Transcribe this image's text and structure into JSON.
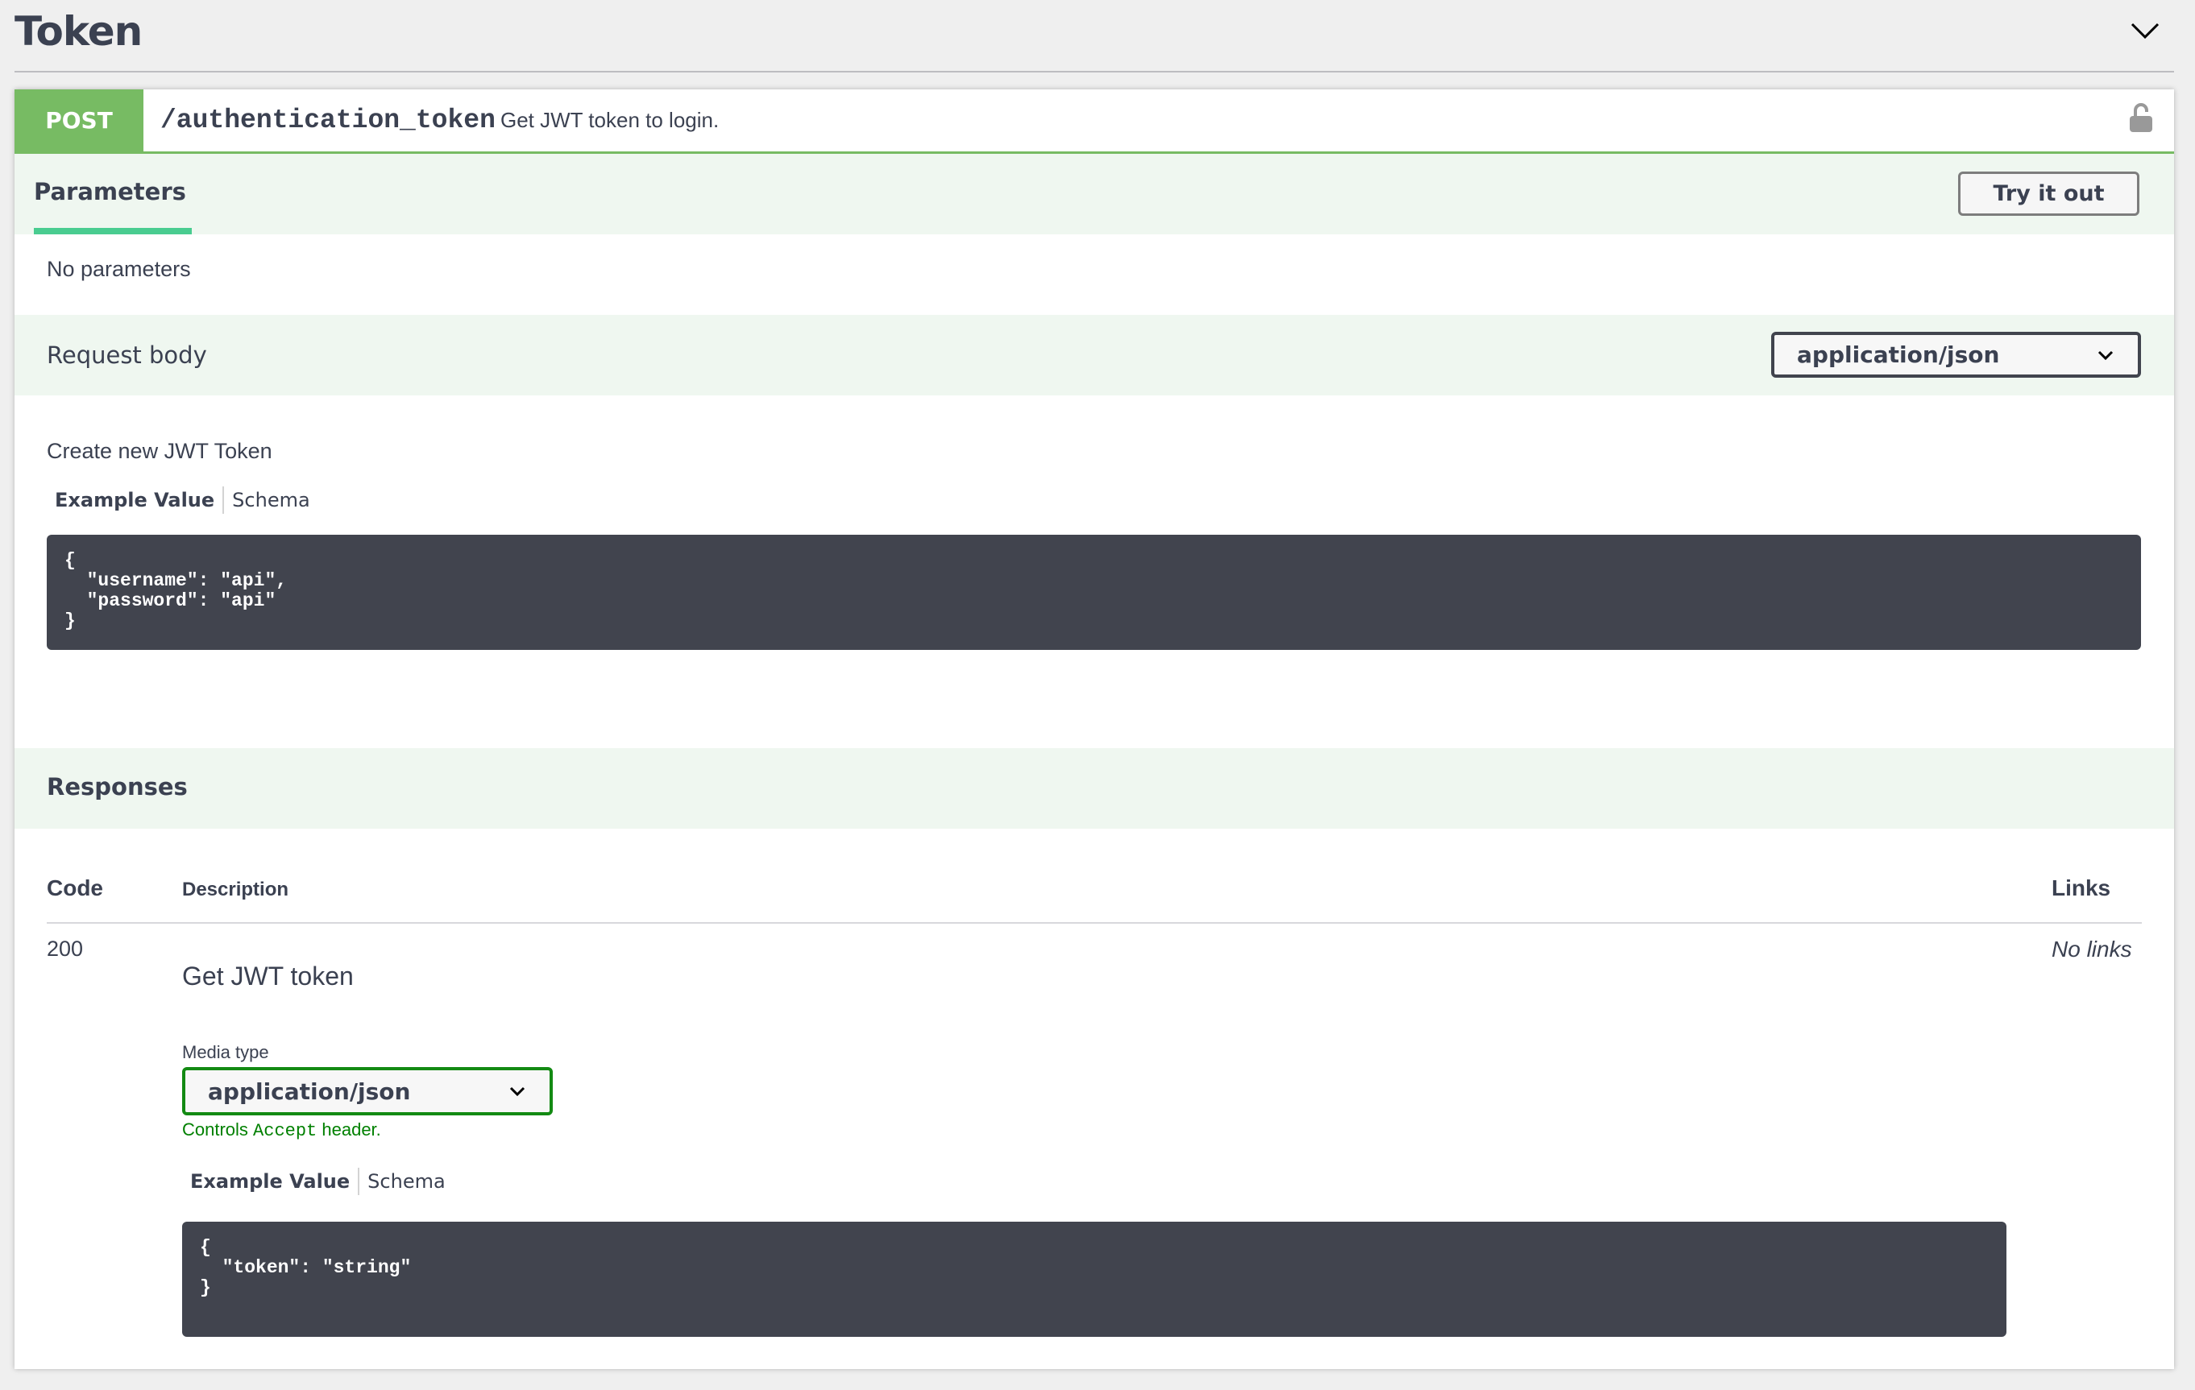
{
  "tag": {
    "title": "Token",
    "collapse_icon": "chevron-down-icon"
  },
  "operation": {
    "method": "POST",
    "method_color": "#77bb63",
    "path": "/authentication_token",
    "summary": "Get JWT token to login.",
    "lock_icon": "unlocked-padlock-icon"
  },
  "parameters": {
    "tab_label": "Parameters",
    "try_it_out_label": "Try it out",
    "empty_text": "No parameters"
  },
  "request_body": {
    "label": "Request body",
    "content_type": "application/json",
    "description": "Create new JWT Token",
    "tabs": {
      "example": "Example Value",
      "schema": "Schema"
    },
    "example": "{\n  \"username\": \"api\",\n  \"password\": \"api\"\n}"
  },
  "responses": {
    "title": "Responses",
    "columns": {
      "code": "Code",
      "description": "Description",
      "links": "Links"
    },
    "rows": [
      {
        "code": "200",
        "description": "Get JWT token",
        "links": "No links",
        "media_type_label": "Media type",
        "media_type": "application/json",
        "controls_prefix": "Controls ",
        "controls_code": "Accept",
        "controls_suffix": " header.",
        "tabs": {
          "example": "Example Value",
          "schema": "Schema"
        },
        "example": "{\n  \"token\": \"string\"\n}"
      }
    ]
  },
  "colors": {
    "accent_green": "#49cc90",
    "band_background": "#eff7f0",
    "code_background": "#41444e",
    "media_select_border": "#138a13"
  }
}
